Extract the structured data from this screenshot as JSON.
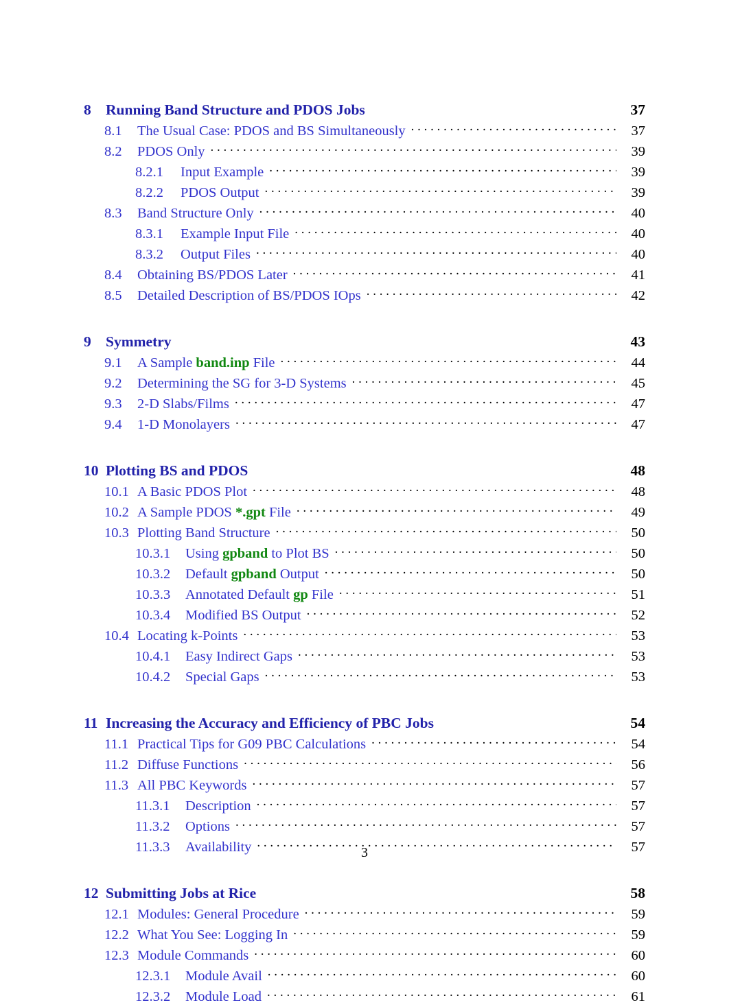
{
  "document": {
    "type": "table-of-contents",
    "folio": "3"
  },
  "colors": {
    "section_heading": "#2222aa",
    "subsection_link": "#3333cc",
    "code_link": "#118811",
    "page_number": "#000000"
  },
  "toc": {
    "groups": [
      {
        "section": {
          "number": "8",
          "title": "Running Band Structure and PDOS Jobs",
          "page": "37"
        },
        "entries": [
          {
            "level": "sub",
            "number": "8.1",
            "title": "The Usual Case: PDOS and BS Simultaneously",
            "page": "37"
          },
          {
            "level": "sub",
            "number": "8.2",
            "title": "PDOS Only",
            "page": "39"
          },
          {
            "level": "subsub",
            "number": "8.2.1",
            "title": "Input Example",
            "page": "39"
          },
          {
            "level": "subsub",
            "number": "8.2.2",
            "title": "PDOS Output",
            "page": "39"
          },
          {
            "level": "sub",
            "number": "8.3",
            "title": "Band Structure Only",
            "page": "40"
          },
          {
            "level": "subsub",
            "number": "8.3.1",
            "title": "Example Input File",
            "page": "40"
          },
          {
            "level": "subsub",
            "number": "8.3.2",
            "title": "Output Files",
            "page": "40"
          },
          {
            "level": "sub",
            "number": "8.4",
            "title": "Obtaining BS/PDOS Later",
            "page": "41"
          },
          {
            "level": "sub",
            "number": "8.5",
            "title": "Detailed Description of BS/PDOS IOps",
            "page": "42"
          }
        ]
      },
      {
        "section": {
          "number": "9",
          "title": "Symmetry",
          "page": "43"
        },
        "entries": [
          {
            "level": "sub",
            "number": "9.1",
            "title_parts": [
              {
                "text": "A Sample ",
                "style": "plain"
              },
              {
                "text": "band.inp",
                "style": "code"
              },
              {
                "text": " File",
                "style": "plain"
              }
            ],
            "title": "A Sample band.inp File",
            "page": "44"
          },
          {
            "level": "sub",
            "number": "9.2",
            "title": "Determining the SG for 3-D Systems",
            "page": "45"
          },
          {
            "level": "sub",
            "number": "9.3",
            "title": "2-D Slabs/Films",
            "page": "47"
          },
          {
            "level": "sub",
            "number": "9.4",
            "title": "1-D Monolayers",
            "page": "47"
          }
        ]
      },
      {
        "section": {
          "number": "10",
          "title": "Plotting BS and PDOS",
          "page": "48"
        },
        "entries": [
          {
            "level": "sub",
            "number": "10.1",
            "title": "A Basic PDOS Plot",
            "page": "48"
          },
          {
            "level": "sub",
            "number": "10.2",
            "title_parts": [
              {
                "text": "A Sample PDOS ",
                "style": "plain"
              },
              {
                "text": "*.gpt",
                "style": "code"
              },
              {
                "text": " File",
                "style": "plain"
              }
            ],
            "title": "A Sample PDOS *.gpt File",
            "page": "49"
          },
          {
            "level": "sub",
            "number": "10.3",
            "title": "Plotting Band Structure",
            "page": "50"
          },
          {
            "level": "subsub",
            "number": "10.3.1",
            "title_parts": [
              {
                "text": "Using ",
                "style": "plain"
              },
              {
                "text": "gpband",
                "style": "code"
              },
              {
                "text": " to Plot BS",
                "style": "plain"
              }
            ],
            "title": "Using gpband to Plot BS",
            "page": "50"
          },
          {
            "level": "subsub",
            "number": "10.3.2",
            "title_parts": [
              {
                "text": "Default ",
                "style": "plain"
              },
              {
                "text": "gpband",
                "style": "code"
              },
              {
                "text": " Output",
                "style": "plain"
              }
            ],
            "title": "Default gpband Output",
            "page": "50"
          },
          {
            "level": "subsub",
            "number": "10.3.3",
            "title_parts": [
              {
                "text": "Annotated Default ",
                "style": "plain"
              },
              {
                "text": "gp",
                "style": "code"
              },
              {
                "text": " File",
                "style": "plain"
              }
            ],
            "title": "Annotated Default gp File",
            "page": "51"
          },
          {
            "level": "subsub",
            "number": "10.3.4",
            "title": "Modified BS Output",
            "page": "52"
          },
          {
            "level": "sub",
            "number": "10.4",
            "title": "Locating k-Points",
            "page": "53"
          },
          {
            "level": "subsub",
            "number": "10.4.1",
            "title": "Easy Indirect Gaps",
            "page": "53"
          },
          {
            "level": "subsub",
            "number": "10.4.2",
            "title": "Special Gaps",
            "page": "53"
          }
        ]
      },
      {
        "section": {
          "number": "11",
          "title": "Increasing the Accuracy and Efficiency of PBC Jobs",
          "page": "54"
        },
        "entries": [
          {
            "level": "sub",
            "number": "11.1",
            "title": "Practical Tips for G09 PBC Calculations",
            "page": "54"
          },
          {
            "level": "sub",
            "number": "11.2",
            "title": "Diffuse Functions",
            "page": "56"
          },
          {
            "level": "sub",
            "number": "11.3",
            "title": "All PBC Keywords",
            "page": "57"
          },
          {
            "level": "subsub",
            "number": "11.3.1",
            "title": "Description",
            "page": "57"
          },
          {
            "level": "subsub",
            "number": "11.3.2",
            "title": "Options",
            "page": "57"
          },
          {
            "level": "subsub",
            "number": "11.3.3",
            "title": "Availability",
            "page": "57"
          }
        ]
      },
      {
        "section": {
          "number": "12",
          "title": "Submitting Jobs at Rice",
          "page": "58"
        },
        "entries": [
          {
            "level": "sub",
            "number": "12.1",
            "title": "Modules: General Procedure",
            "page": "59"
          },
          {
            "level": "sub",
            "number": "12.2",
            "title": "What You See: Logging In",
            "page": "59"
          },
          {
            "level": "sub",
            "number": "12.3",
            "title": "Module Commands",
            "page": "60"
          },
          {
            "level": "subsub",
            "number": "12.3.1",
            "title": "Module Avail",
            "page": "60"
          },
          {
            "level": "subsub",
            "number": "12.3.2",
            "title": "Module Load",
            "page": "61"
          }
        ]
      }
    ]
  }
}
